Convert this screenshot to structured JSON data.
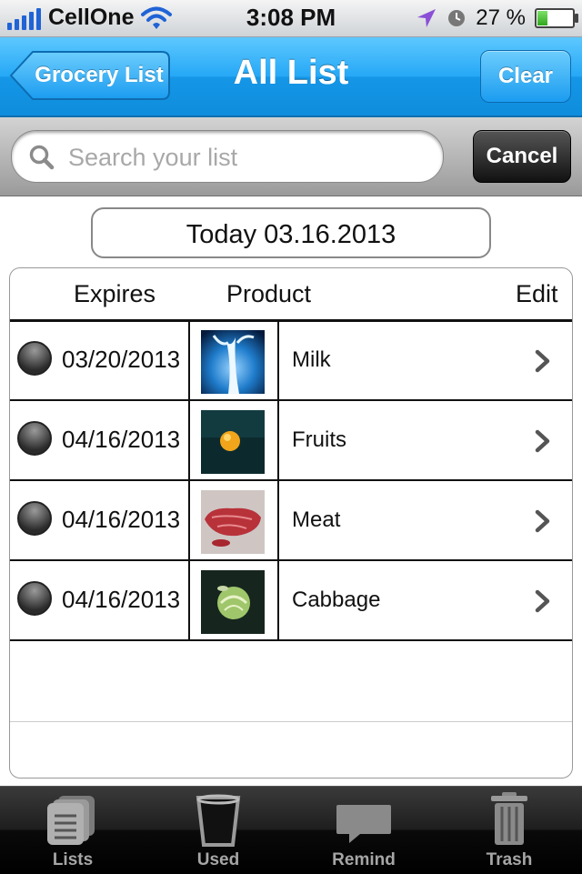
{
  "status_bar": {
    "carrier": "CellOne",
    "time": "3:08 PM",
    "battery_percent": "27 %",
    "battery_level": 0.27
  },
  "nav": {
    "back_label": "Grocery List",
    "title": "All List",
    "clear_label": "Clear"
  },
  "search": {
    "placeholder": "Search your list",
    "value": "",
    "cancel_label": "Cancel"
  },
  "date_label": "Today 03.16.2013",
  "table": {
    "headers": {
      "expires": "Expires",
      "product": "Product",
      "edit": "Edit"
    },
    "rows": [
      {
        "expires": "03/20/2013",
        "product": "Milk",
        "thumb": "milk-splash"
      },
      {
        "expires": "04/16/2013",
        "product": "Fruits",
        "thumb": "orange-fruit"
      },
      {
        "expires": "04/16/2013",
        "product": "Meat",
        "thumb": "raw-steak"
      },
      {
        "expires": "04/16/2013",
        "product": "Cabbage",
        "thumb": "cabbage"
      }
    ]
  },
  "tabs": [
    {
      "label": "Lists",
      "icon": "lists-icon"
    },
    {
      "label": "Used",
      "icon": "glass-icon"
    },
    {
      "label": "Remind",
      "icon": "speech-bubble-icon"
    },
    {
      "label": "Trash",
      "icon": "trash-can-icon"
    }
  ],
  "colors": {
    "nav_blue": "#25a8f6",
    "search_gray": "#b5b5b5",
    "tab_bar_black": "#1e1e1e"
  }
}
